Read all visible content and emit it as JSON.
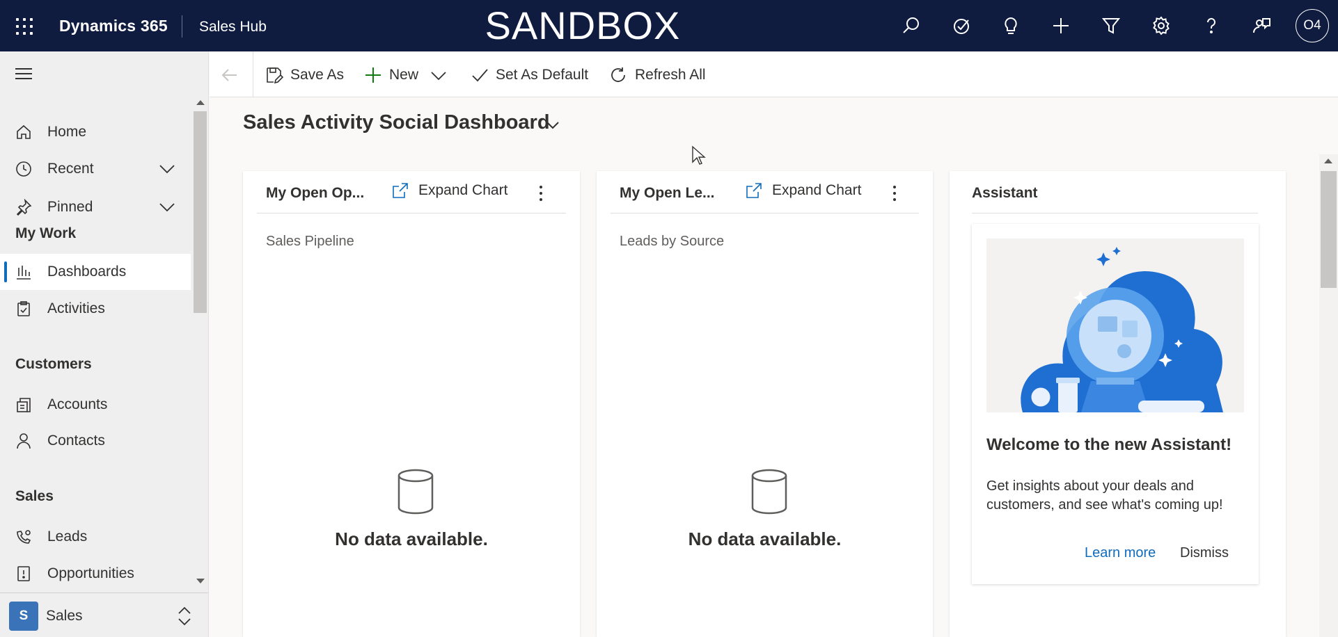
{
  "topbar": {
    "app_name": "Dynamics 365",
    "hub_name": "Sales Hub",
    "environment_banner": "SANDBOX",
    "user_initials": "O4",
    "icons": [
      "search-icon",
      "task-icon",
      "lightbulb-icon",
      "plus-icon",
      "filter-icon",
      "settings-icon",
      "help-icon",
      "feedback-icon"
    ]
  },
  "sidebar": {
    "home": "Home",
    "recent": "Recent",
    "pinned": "Pinned",
    "my_work_title": "My Work",
    "dashboards": "Dashboards",
    "activities": "Activities",
    "customers_title": "Customers",
    "accounts": "Accounts",
    "contacts": "Contacts",
    "sales_title": "Sales",
    "leads": "Leads",
    "opportunities": "Opportunities",
    "area_badge": "S",
    "area_label": "Sales"
  },
  "commandbar": {
    "save_as": "Save As",
    "new": "New",
    "set_as_default": "Set As Default",
    "refresh_all": "Refresh All"
  },
  "dashboard": {
    "title": "Sales Activity Social Dashboard"
  },
  "cards": [
    {
      "title": "My Open Op...",
      "expand_label": "Expand Chart",
      "chart_name": "Sales Pipeline",
      "empty_text": "No data available."
    },
    {
      "title": "My Open Le...",
      "expand_label": "Expand Chart",
      "chart_name": "Leads by Source",
      "empty_text": "No data available."
    }
  ],
  "assistant": {
    "title": "Assistant",
    "welcome": "Welcome to the new Assistant!",
    "description": "Get insights about your deals and customers, and see what's coming up!",
    "learn_more": "Learn more",
    "dismiss": "Dismiss"
  },
  "colors": {
    "topbar_bg": "#0f1c3f",
    "accent": "#0f6cbd",
    "sidebar_bg": "#efefef",
    "area_badge_bg": "#3b73b9"
  }
}
